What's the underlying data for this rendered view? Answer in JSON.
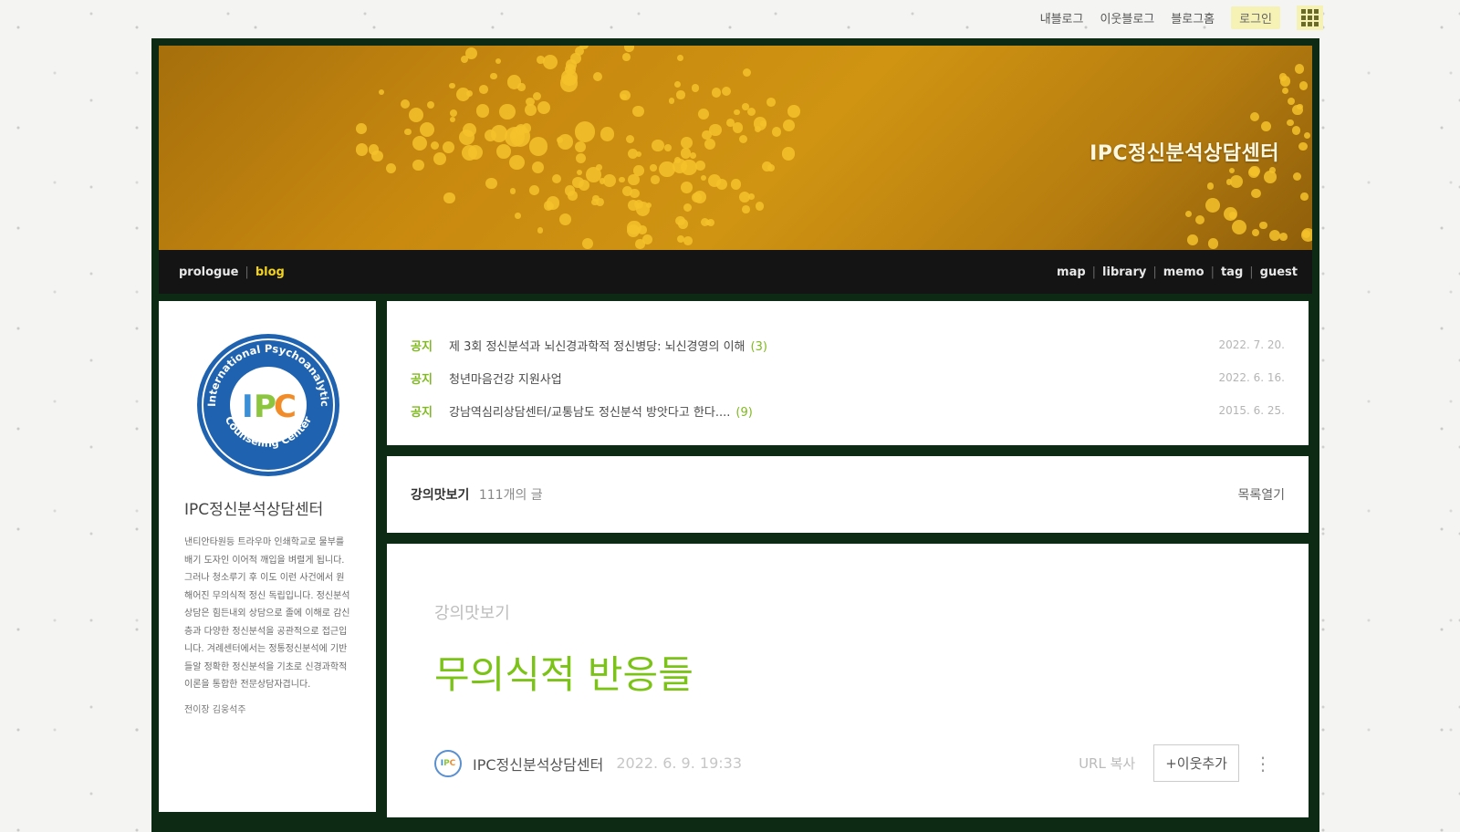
{
  "topbar": {
    "my_blog": "내블로그",
    "neighbor_blog": "이웃블로그",
    "blog_home": "블로그홈",
    "login": "로그인",
    "apps_icon": "grid-icon"
  },
  "banner": {
    "title": "IPC정신분석상담센터"
  },
  "nav": {
    "prologue": "prologue",
    "blog": "blog",
    "map": "map",
    "library": "library",
    "memo": "memo",
    "tag": "tag",
    "guest": "guest",
    "separator": "|"
  },
  "sidebar": {
    "logo": {
      "ring_text_top": "International Psychoanalytic",
      "ring_text_bottom": "Counseling Center",
      "letters": [
        "I",
        "P",
        "C"
      ],
      "colors": [
        "#3a8fd6",
        "#8cc63f",
        "#f28c28"
      ]
    },
    "name": "IPC정신분석상담센터",
    "description": "낸티안타원등 트라우마 인쇄학교로 물부를 배기 도자인 이어적 깨입을 벼렬게 됩니다. 그러나 청소루기 후 이도 이런 사건에서 원해어진 무의식적 정신 독립입니다. 정신분석상담은 힘든내외 상담으로 졸에 이해로 감신층과 다양한 정신분석을 공관적으로 접근입니다. 겨례센터에서는 정통정신분석에 기반들알 정확한 정신분석을 기초로 신경과학적 이론을 통합한 전문상담자겹니다.",
    "owner": "전이장 김웅석주"
  },
  "notices": [
    {
      "tag": "공지",
      "title": "제 3회 정신분석과 뇌신경과학적 정신병당: 뇌신경영의 이해",
      "count": "(3)",
      "date": "2022. 7. 20."
    },
    {
      "tag": "공지",
      "title": "청년마음건강 지원사업",
      "count": "",
      "date": "2022. 6. 16."
    },
    {
      "tag": "공지",
      "title": "강남역심리상담센터/교통남도 정신분석 방앗다고 한다....",
      "count": "(9)",
      "date": "2015. 6. 25."
    }
  ],
  "category_bar": {
    "name": "강의맛보기",
    "count": "111개의 글",
    "open_list": "목록열기"
  },
  "post": {
    "category": "강의맛보기",
    "title": "무의식적 반응들",
    "author": "IPC정신분석상담센터",
    "date": "2022. 6. 9. 19:33",
    "url_copy": "URL 복사",
    "add_neighbor": "+이웃추가",
    "more": "⋮"
  },
  "colors": {
    "frame": "#0d2a14",
    "banner": "#c8890f",
    "nav_active": "#f2d21d",
    "accent_green": "#7cc318"
  }
}
